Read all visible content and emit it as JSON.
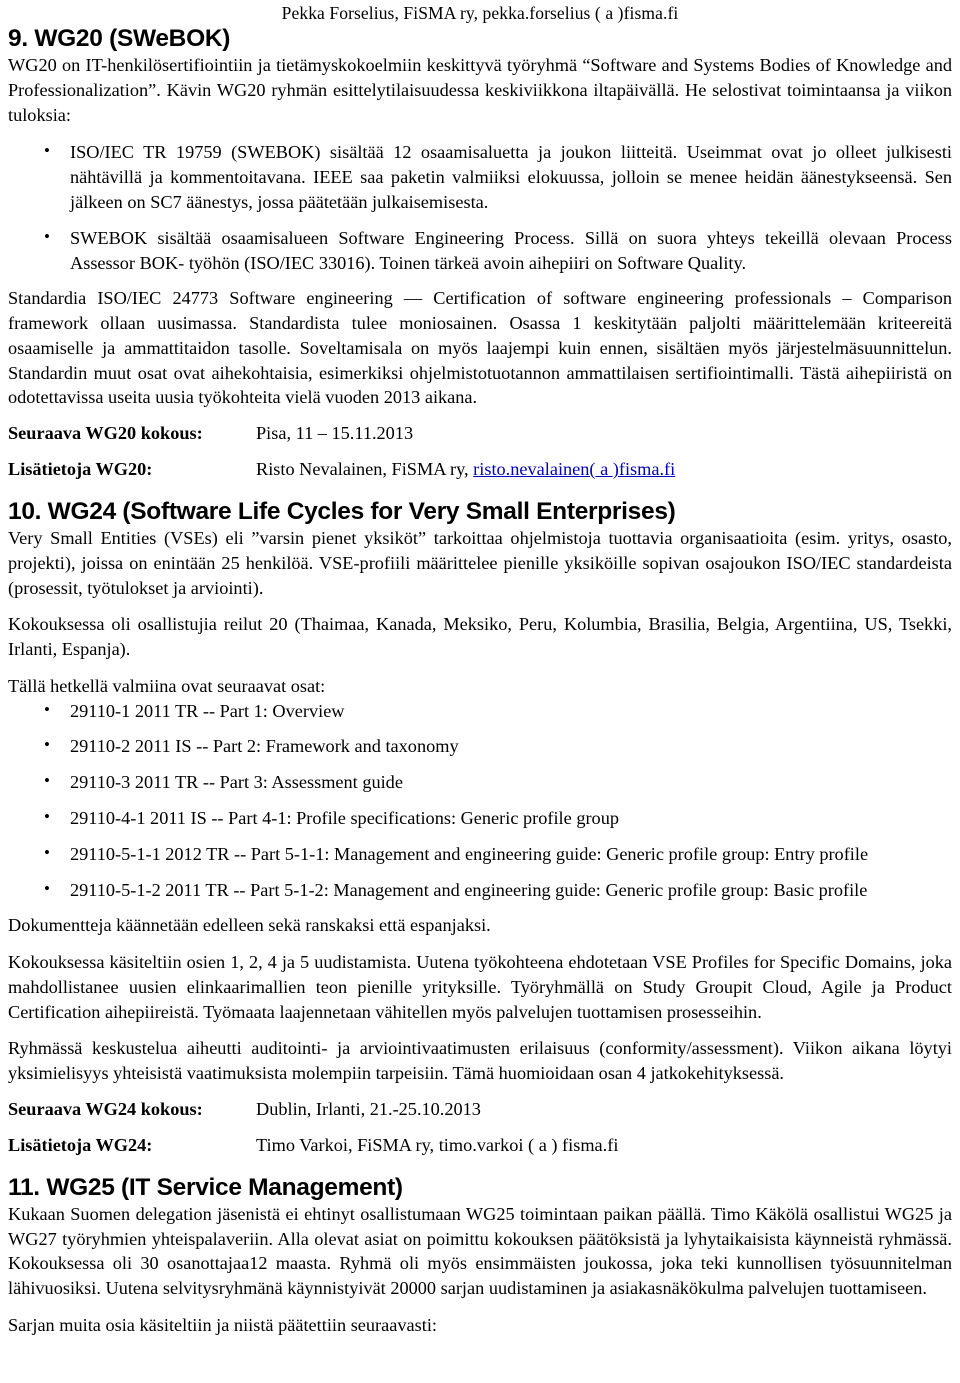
{
  "header": {
    "contact_line": "Pekka Forselius, FiSMA ry, pekka.forselius ( a )fisma.fi"
  },
  "sections": [
    {
      "heading": "9. WG20 (SWeBOK)",
      "intro": "WG20 on IT-henkilösertifiointiin ja  tietämyskokoelmiin keskittyvä työryhmä “Software and Systems Bodies of Knowledge and Professionalization”. Kävin WG20 ryhmän esittelytilaisuudessa keskiviikkona iltapäivällä. He selostivat toimintaansa ja viikon tuloksia:",
      "bullets": [
        "ISO/IEC TR 19759 (SWEBOK) sisältää 12 osaamisaluetta ja joukon liitteitä. Useimmat ovat jo olleet julkisesti nähtävillä ja kommentoitavana. IEEE saa paketin valmiiksi elokuussa, jolloin se menee heidän äänestykseensä. Sen jälkeen on SC7 äänestys, jossa päätetään julkaisemisesta.",
        "SWEBOK sisältää osaamisalueen Software Engineering Process. Sillä on suora yhteys tekeillä olevaan Process Assessor BOK- työhön (ISO/IEC 33016). Toinen tärkeä avoin aihepiiri on Software Quality."
      ],
      "paragraph": "Standardia ISO/IEC 24773 Software engineering — Certification of software engineering professionals – Comparison framework ollaan uusimassa. Standardista tulee moniosainen. Osassa 1 keskitytään paljolti määrittelemään kriteereitä osaamiselle ja ammattitaidon tasolle. Soveltamisala on myös laajempi kuin ennen, sisältäen myös järjestelmäsuunnittelun. Standardin muut osat ovat aihekohtaisia, esimerkiksi ohjelmistotuotannon ammattilaisen sertifiointimalli. Tästä aihepiiristä on odotettavissa useita uusia työkohteita vielä vuoden 2013 aikana.",
      "meta": [
        {
          "label": "Seuraava WG20 kokous:",
          "value": "Pisa, 11 – 15.11.2013",
          "link": null,
          "value_prefix": null
        },
        {
          "label": "Lisätietoja WG20:",
          "value": null,
          "value_prefix": "Risto Nevalainen, FiSMA ry, ",
          "link": "risto.nevalainen( a )fisma.fi"
        }
      ]
    },
    {
      "heading": "10. WG24 (Software Life Cycles for Very Small Enterprises)",
      "paragraphs": [
        "Very Small Entities (VSEs) eli ”varsin pienet yksiköt” tarkoittaa ohjelmistoja tuottavia organisaatioita (esim. yritys, osasto, projekti), joissa on enintään 25 henkilöä. VSE-profiili määrittelee pienille yksiköille sopivan osajoukon ISO/IEC standardeista (prosessit, työtulokset ja arviointi).",
        "Kokouksessa oli osallistujia reilut 20 (Thaimaa, Kanada, Meksiko, Peru, Kolumbia, Brasilia, Belgia, Argentiina, US, Tsekki, Irlanti, Espanja)."
      ],
      "list_intro": "Tällä hetkellä valmiina ovat seuraavat osat:",
      "bullets": [
        "29110-1 2011 TR -- Part 1: Overview",
        "29110-2 2011 IS -- Part 2: Framework and taxonomy",
        "29110-3 2011 TR -- Part 3: Assessment guide",
        "29110-4-1 2011 IS -- Part 4-1: Profile specifications: Generic profile group",
        "29110-5-1-1 2012 TR -- Part 5-1-1: Management and engineering guide: Generic profile group: Entry profile",
        "29110-5-1-2 2011 TR -- Part 5-1-2: Management and engineering guide: Generic profile group: Basic profile"
      ],
      "after_paragraphs": [
        "Dokumentteja käännetään edelleen sekä ranskaksi että espanjaksi.",
        "Kokouksessa käsiteltiin osien 1, 2, 4 ja 5 uudistamista. Uutena työkohteena ehdotetaan VSE Profiles for Specific Domains, joka mahdollistanee uusien elinkaarimallien teon pienille yrityksille. Työryhmällä on Study Groupit Cloud, Agile ja Product Certification aihepiireistä. Työmaata laajennetaan vähitellen myös palvelujen tuottamisen prosesseihin.",
        "Ryhmässä keskustelua aiheutti auditointi- ja arviointivaatimusten erilaisuus (conformity/assessment). Viikon aikana löytyi yksimielisyys yhteisistä vaatimuksista molempiin tarpeisiin. Tämä huomioidaan osan 4 jatkokehityksessä."
      ],
      "meta": [
        {
          "label": "Seuraava WG24 kokous:",
          "value": "Dublin, Irlanti, 21.-25.10.2013",
          "link": null,
          "value_prefix": null
        },
        {
          "label": "Lisätietoja WG24:",
          "value": "Timo Varkoi, FiSMA ry, timo.varkoi ( a ) fisma.fi",
          "link": null,
          "value_prefix": null
        }
      ]
    },
    {
      "heading": "11. WG25 (IT Service Management)",
      "paragraphs": [
        "Kukaan Suomen delegation jäsenistä ei ehtinyt osallistumaan WG25 toimintaan paikan päällä. Timo Käkölä osallistui WG25 ja WG27 työryhmien yhteispalaveriin. Alla olevat asiat on poimittu kokouksen päätöksistä ja lyhytaikaisista käynneistä ryhmässä. Kokouksessa oli 30 osanottajaa12 maasta. Ryhmä oli myös ensimmäisten joukossa, joka teki kunnollisen työsuunnitelman lähivuosiksi. Uutena selvitysryhmänä käynnistyivät 20000 sarjan uudistaminen ja asiakasnäkökulma palvelujen tuottamiseen.",
        "Sarjan muita osia käsiteltiin ja niistä päätettiin seuraavasti:"
      ]
    }
  ],
  "colors": {
    "text": "#000000",
    "link": "#0000c0",
    "background": "#ffffff"
  }
}
